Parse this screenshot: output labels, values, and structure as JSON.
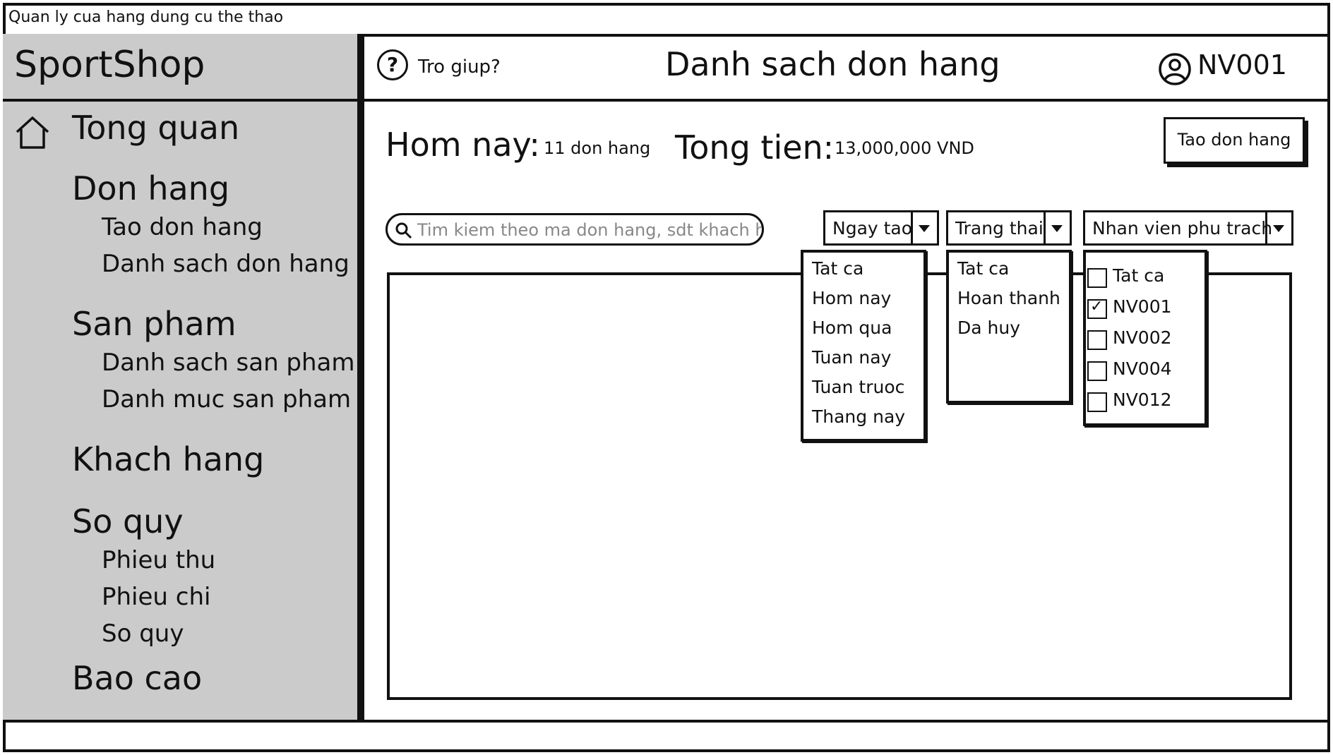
{
  "window": {
    "title": "Quan ly cua hang dung cu the thao"
  },
  "sidebar": {
    "brand": "SportShop",
    "sections": [
      {
        "label": "Tong quan",
        "items": []
      },
      {
        "label": "Don hang",
        "items": [
          "Tao don hang",
          "Danh sach don hang"
        ]
      },
      {
        "label": "San pham",
        "items": [
          "Danh sach san pham",
          "Danh muc san pham"
        ]
      },
      {
        "label": "Khach hang",
        "items": []
      },
      {
        "label": "So quy",
        "items": [
          "Phieu thu",
          "Phieu chi",
          "So quy"
        ]
      },
      {
        "label": "Bao cao",
        "items": []
      }
    ]
  },
  "header": {
    "help_label": "Tro giup?",
    "help_glyph": "?",
    "title": "Danh sach don hang",
    "user": "NV001"
  },
  "stats": {
    "today_label": "Hom nay:",
    "today_value": "11 don hang",
    "total_label": "Tong tien:",
    "total_value": "13,000,000 VND"
  },
  "create_button": "Tao don hang",
  "search": {
    "placeholder": "Tim kiem theo ma don hang, sdt khach hang"
  },
  "filters": {
    "date": {
      "label": "Ngay tao",
      "options": [
        "Tat ca",
        "Hom nay",
        "Hom qua",
        "Tuan nay",
        "Tuan truoc",
        "Thang nay"
      ]
    },
    "status": {
      "label": "Trang thai",
      "options": [
        "Tat ca",
        "Hoan thanh",
        "Da huy"
      ]
    },
    "staff": {
      "label": "Nhan vien phu trach",
      "options": [
        {
          "label": "Tat ca",
          "checked": false
        },
        {
          "label": "NV001",
          "checked": true
        },
        {
          "label": "NV002",
          "checked": false
        },
        {
          "label": "NV004",
          "checked": false
        },
        {
          "label": "NV012",
          "checked": false
        }
      ]
    }
  }
}
